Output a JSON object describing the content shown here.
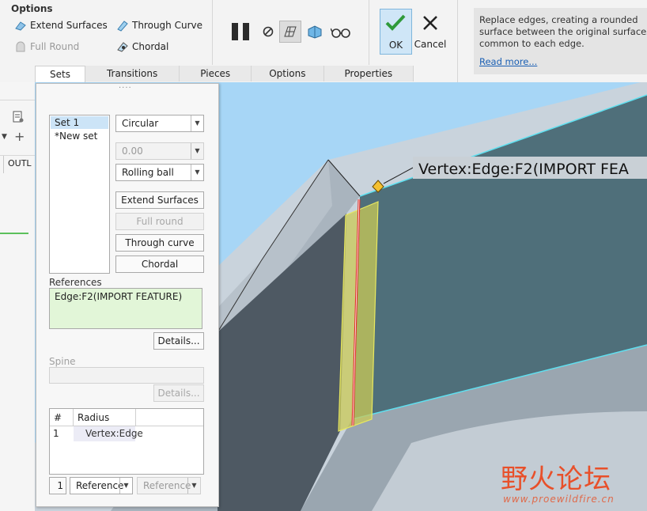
{
  "ribbon": {
    "options_title": "Options",
    "extend_surfaces": "Extend Surfaces",
    "through_curve": "Through Curve",
    "full_round": "Full Round",
    "chordal": "Chordal",
    "ok_label": "OK",
    "cancel_label": "Cancel"
  },
  "tabs": [
    "Sets",
    "Transitions",
    "Pieces",
    "Options",
    "Properties"
  ],
  "help": {
    "text": "Replace edges, creating a rounded surface between the original surfaces common to each edge.",
    "read_more": "Read more..."
  },
  "left_strip": {
    "outline_label": "OUTL"
  },
  "sets_panel": {
    "sets_list": [
      "Set 1",
      "*New set"
    ],
    "shape_dropdown": "Circular",
    "value_field": "0.00",
    "method_dropdown": "Rolling ball",
    "extend_surfaces_btn": "Extend Surfaces",
    "full_round_btn": "Full round",
    "through_curve_btn": "Through curve",
    "chordal_btn": "Chordal",
    "references_label": "References",
    "references_value": "Edge:F2(IMPORT FEATURE)",
    "details_btn": "Details...",
    "spine_label": "Spine",
    "spine_details_btn": "Details...",
    "table_headers": [
      "#",
      "Radius"
    ],
    "table_rows": [
      {
        "num": "1",
        "radius": "Vertex:Edge"
      }
    ],
    "bottom_num": "1",
    "reference_dd_1": "Reference",
    "reference_dd_2": "Reference"
  },
  "viewport": {
    "vertex_label": "Vertex:Edge:F2(IMPORT FEA"
  },
  "watermark": {
    "cn": "野火论坛",
    "url": "www.proewildfire.cn"
  },
  "colors": {
    "accent_blue": "#1a5fb4",
    "ok_bg": "#cfe6f7",
    "sky": "#a7d6f6",
    "surface_dark": "#4f6f7a",
    "round_yellow": "#e8e860",
    "edge_red": "#e0302a"
  }
}
